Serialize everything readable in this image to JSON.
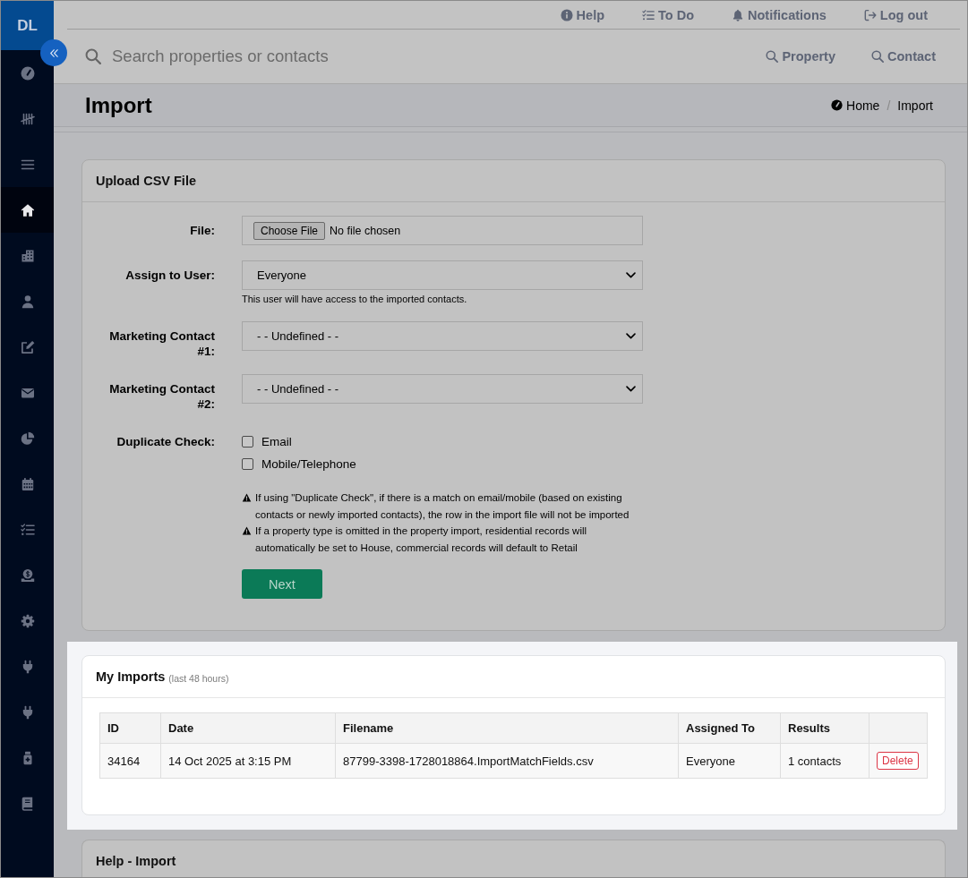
{
  "sidebar": {
    "brand": "DL",
    "items": [
      {
        "selected": false
      },
      {
        "selected": false
      },
      {
        "selected": false
      },
      {
        "selected": true
      },
      {
        "selected": false
      },
      {
        "selected": false
      },
      {
        "selected": false
      },
      {
        "selected": false
      },
      {
        "selected": false
      },
      {
        "selected": false
      },
      {
        "selected": false
      },
      {
        "selected": false
      },
      {
        "selected": false
      },
      {
        "selected": false
      },
      {
        "selected": false
      },
      {
        "selected": false
      },
      {
        "selected": false
      }
    ]
  },
  "top_nav": {
    "links": [
      {
        "label": "Help"
      },
      {
        "label": "To Do"
      },
      {
        "label": "Notifications"
      },
      {
        "label": "Log out"
      }
    ]
  },
  "search": {
    "placeholder": "Search properties or contacts",
    "buttons": [
      {
        "label": "Property"
      },
      {
        "label": "Contact"
      }
    ]
  },
  "page_header": {
    "title": "Import",
    "breadcrumb": {
      "items": [
        {
          "label": "Home"
        },
        {
          "label": "Import"
        }
      ],
      "separator": "/"
    }
  },
  "cards": [
    {
      "kind": "form",
      "title": "Upload CSV File",
      "highlighted": false,
      "fields": [
        {
          "kind": "file",
          "label": "File:",
          "button": "Choose File",
          "value": "No file chosen"
        },
        {
          "kind": "select",
          "label": "Assign to User:",
          "value": "Everyone",
          "help": "This user will have access to the imported contacts."
        },
        {
          "kind": "select",
          "label": "Marketing Contact #1:",
          "value": "- - Undefined - -"
        },
        {
          "kind": "select",
          "label": "Marketing Contact #2:",
          "value": "- - Undefined - -"
        },
        {
          "kind": "checkboxes",
          "label": "Duplicate Check:",
          "options": [
            {
              "label": "Email",
              "checked": false
            },
            {
              "label": "Mobile/Telephone",
              "checked": false
            }
          ]
        }
      ],
      "notes": [
        "If using \"Duplicate Check\", if there is a match on email/mobile (based on existing contacts or newly imported contacts), the row in the import file will not be imported",
        "If a property type is omitted in the property import, residential records will automatically be set to House, commercial records will default to Retail"
      ],
      "submit": "Next"
    },
    {
      "kind": "table",
      "title": "My Imports",
      "subtitle": "(last 48 hours)",
      "highlighted": true,
      "columns": [
        "ID",
        "Date",
        "Filename",
        "Assigned To",
        "Results"
      ],
      "rows": [
        {
          "cells": [
            "34164",
            "14 Oct 2025 at 3:15 PM",
            "87799-3398-1728018864.ImportMatchFields.csv",
            "Everyone",
            "1 contacts"
          ],
          "action": "Delete"
        }
      ]
    },
    {
      "kind": "help",
      "title": "Help - Import",
      "highlighted": false
    }
  ]
}
